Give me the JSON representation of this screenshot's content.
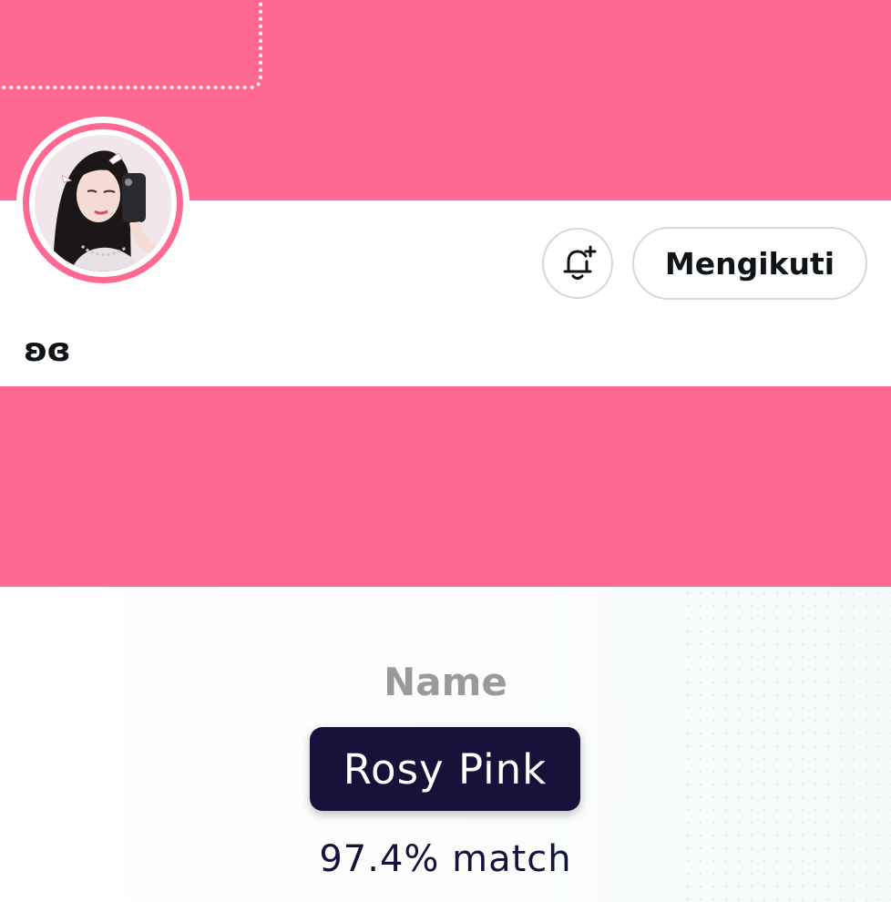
{
  "theme": {
    "banner_color": "#ff6991",
    "pill_color": "#17123a",
    "border_color": "#cfd9de"
  },
  "profile": {
    "display_name": "ʚɞ",
    "follow_label": "Mengikuti",
    "notify_icon": "bell-plus-icon",
    "avatar": "profile-photo"
  },
  "color_result": {
    "label": "Name",
    "color_name": "Rosy Pink",
    "match": "97.4% match"
  }
}
